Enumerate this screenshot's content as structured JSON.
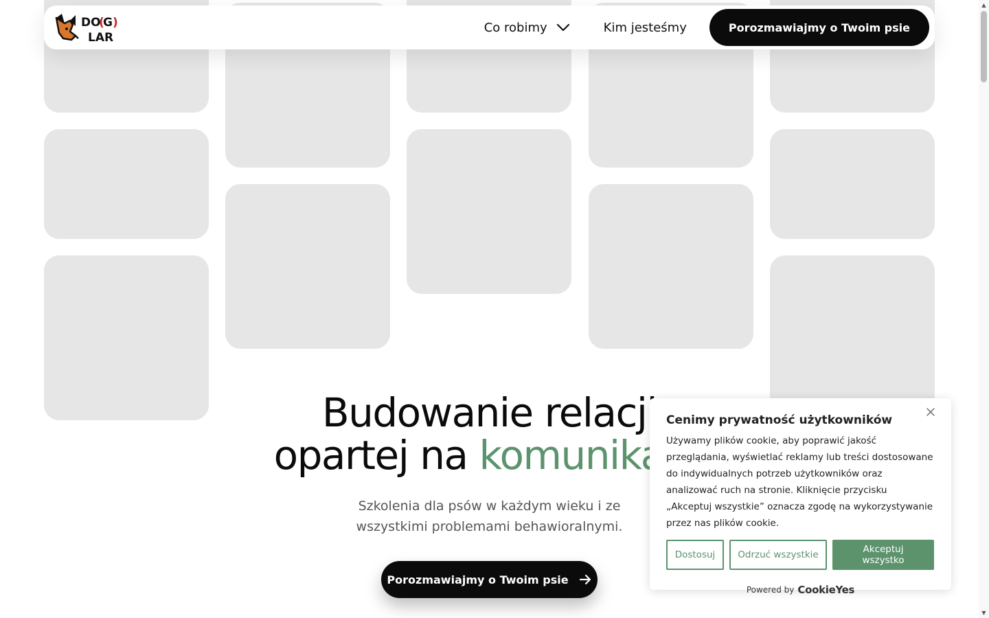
{
  "nav": {
    "services_label": "Co robimy",
    "about_label": "Kim jesteśmy",
    "cta_label": "Porozmawiajmy o Twoim psie"
  },
  "hero": {
    "title_line1": "Budowanie relacji",
    "title_line2_plain": "opartej na ",
    "title_line2_accent": "komunikacji",
    "subtitle_line1": "Szkolenia dla psów w każdym wieku i ze",
    "subtitle_line2": "wszystkimi problemami behawioralnymi.",
    "cta_label": "Porozmawiajmy o Twoim psie"
  },
  "cookie": {
    "title": "Cenimy prywatność użytkowników",
    "body": "Używamy plików cookie, aby poprawić jakość przeglądania, wyświetlać reklamy lub treści dostosowane do indywidualnych potrzeb użytkowników oraz analizować ruch na stronie. Kliknięcie przycisku „Akceptuj wszystkie” oznacza zgodę na wykorzystywanie przez nas plików cookie.",
    "customize_label": "Dostosuj",
    "reject_label": "Odrzuć wszystkie",
    "accept_label": "Akceptuj wszystko",
    "powered_by": "Powered by",
    "powered_brand": "CookieYes"
  },
  "colors": {
    "accent": "#5c936d",
    "dark": "#0b0b0b",
    "tile": "#e6e6e6"
  },
  "icons": {
    "logo": "dog-logo",
    "services_chevron": "chevron-down-icon",
    "hero_cta_icon": "arrow-right-icon",
    "cookie_close": "close-icon"
  }
}
